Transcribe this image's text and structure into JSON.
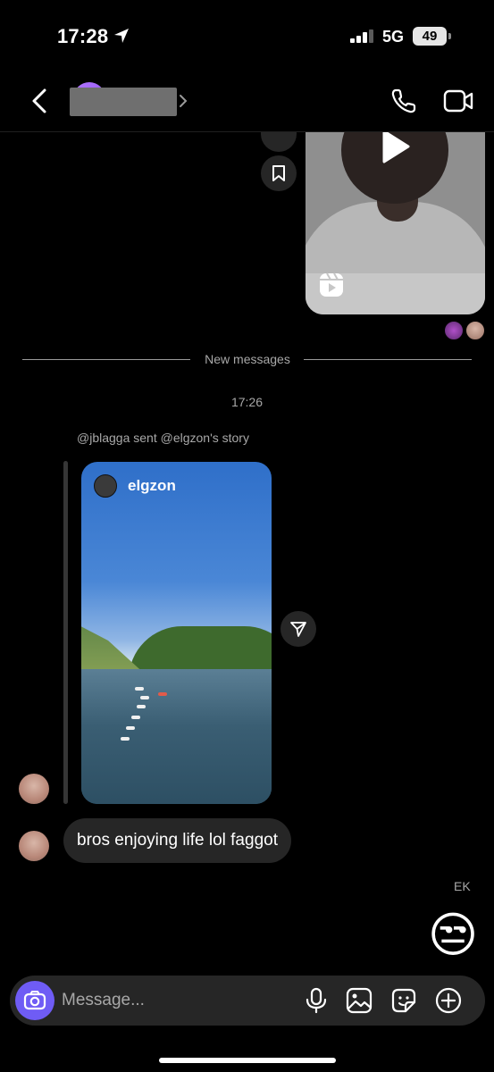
{
  "status_bar": {
    "time": "17:28",
    "network": "5G",
    "battery": "49"
  },
  "header": {
    "contact_name": ""
  },
  "thread": {
    "new_messages_label": "New messages",
    "timestamp": "17:26",
    "story_note": "@jblagga sent @elgzon's story",
    "story": {
      "username": "elgzon"
    },
    "message_text": "bros enjoying life lol faggot",
    "sender_tag": "EK",
    "emoji_reply": "😒"
  },
  "composer": {
    "placeholder": "Message..."
  }
}
